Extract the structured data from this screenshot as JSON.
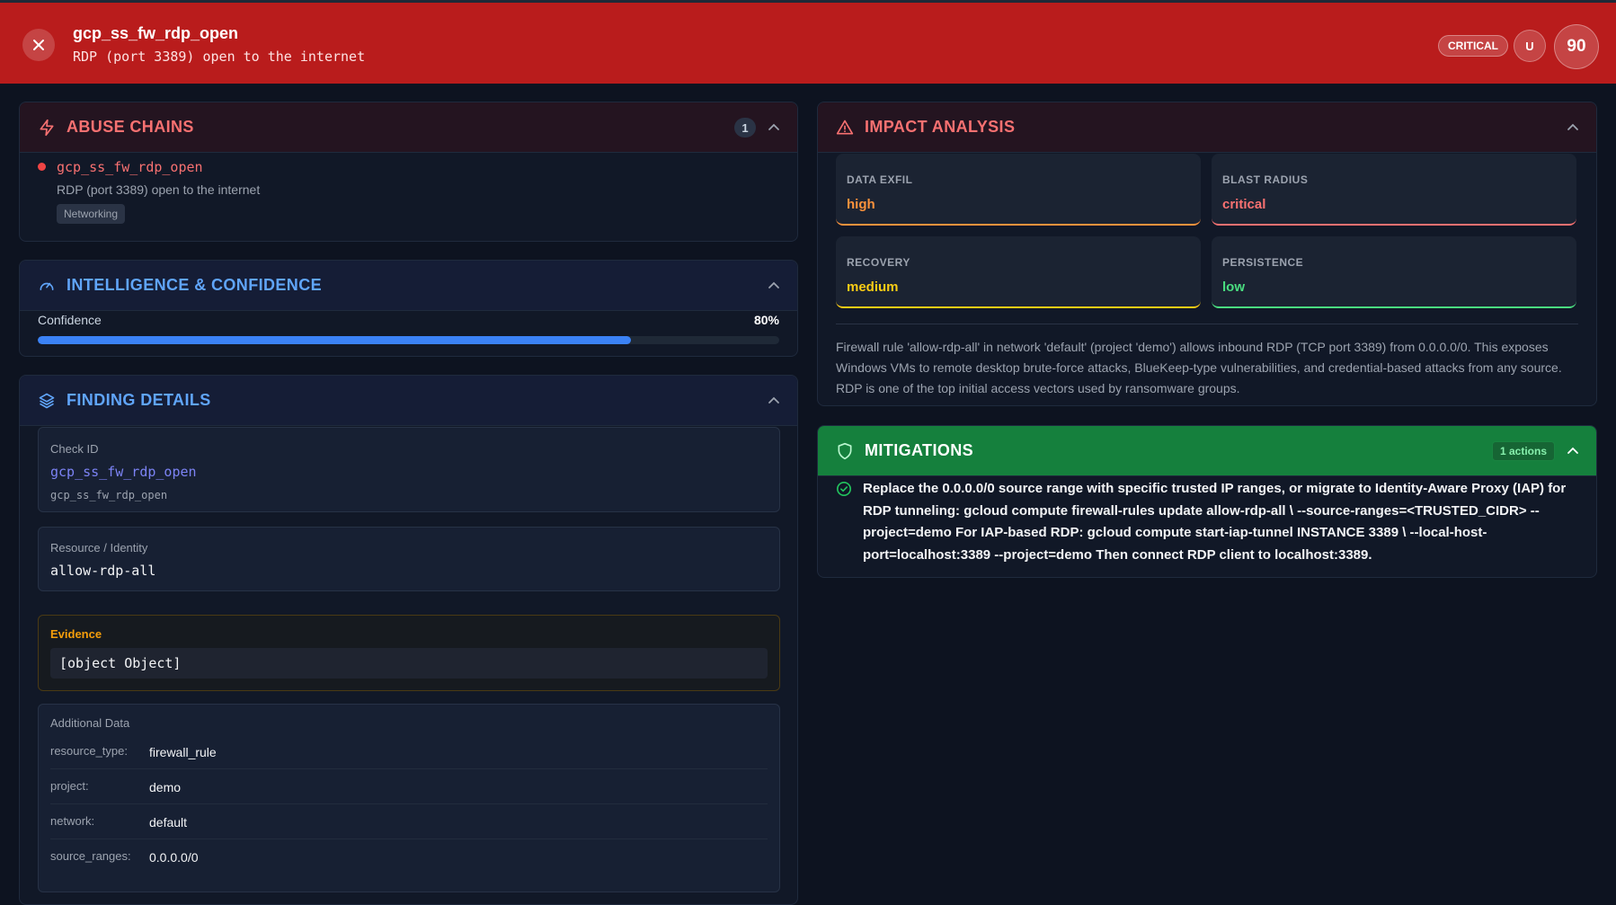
{
  "header": {
    "title": "gcp_ss_fw_rdp_open",
    "subtitle": "RDP (port 3389) open to the internet",
    "severity": "CRITICAL",
    "user_initial": "U",
    "score": "90"
  },
  "abuse_chains": {
    "title": "ABUSE CHAINS",
    "count": "1",
    "items": [
      {
        "name": "gcp_ss_fw_rdp_open",
        "description": "RDP (port 3389) open to the internet",
        "tag": "Networking"
      }
    ]
  },
  "intelligence": {
    "title": "INTELLIGENCE & CONFIDENCE",
    "confidence_label": "Confidence",
    "confidence_value": "80%",
    "confidence_fraction": 0.8
  },
  "finding_details": {
    "title": "FINDING DETAILS",
    "check_id_label": "Check ID",
    "check_id": "gcp_ss_fw_rdp_open",
    "check_id_sub": "gcp_ss_fw_rdp_open",
    "resource_label": "Resource / Identity",
    "resource": "allow-rdp-all",
    "evidence_label": "Evidence",
    "evidence": "[object Object]",
    "additional_label": "Additional Data",
    "additional": [
      {
        "key": "resource_type:",
        "value": "firewall_rule"
      },
      {
        "key": "project:",
        "value": "demo"
      },
      {
        "key": "network:",
        "value": "default"
      },
      {
        "key": "source_ranges:",
        "value": "0.0.0.0/0"
      }
    ]
  },
  "impact": {
    "title": "IMPACT ANALYSIS",
    "cards": [
      {
        "label": "DATA EXFIL",
        "value": "high",
        "color": "#fb923c"
      },
      {
        "label": "BLAST RADIUS",
        "value": "critical",
        "color": "#f87171"
      },
      {
        "label": "RECOVERY",
        "value": "medium",
        "color": "#facc15"
      },
      {
        "label": "PERSISTENCE",
        "value": "low",
        "color": "#4ade80"
      }
    ],
    "description": "Firewall rule 'allow-rdp-all' in network 'default' (project 'demo') allows inbound RDP (TCP port 3389) from 0.0.0.0/0. This exposes Windows VMs to remote desktop brute-force attacks, BlueKeep-type vulnerabilities, and credential-based attacks from any source. RDP is one of the top initial access vectors used by ransomware groups."
  },
  "mitigations": {
    "title": "MITIGATIONS",
    "actions_badge": "1 actions",
    "items": [
      "Replace the 0.0.0.0/0 source range with specific trusted IP ranges, or migrate to Identity-Aware Proxy (IAP) for RDP tunneling: gcloud compute firewall-rules update allow-rdp-all \\ --source-ranges=<TRUSTED_CIDR> --project=demo For IAP-based RDP: gcloud compute start-iap-tunnel INSTANCE 3389 \\ --local-host-port=localhost:3389 --project=demo Then connect RDP client to localhost:3389."
    ]
  },
  "colors": {
    "header_bg": "#b91c1c",
    "accent_red": "#f87171",
    "accent_blue": "#60a5fa",
    "accent_green": "#15803d"
  }
}
